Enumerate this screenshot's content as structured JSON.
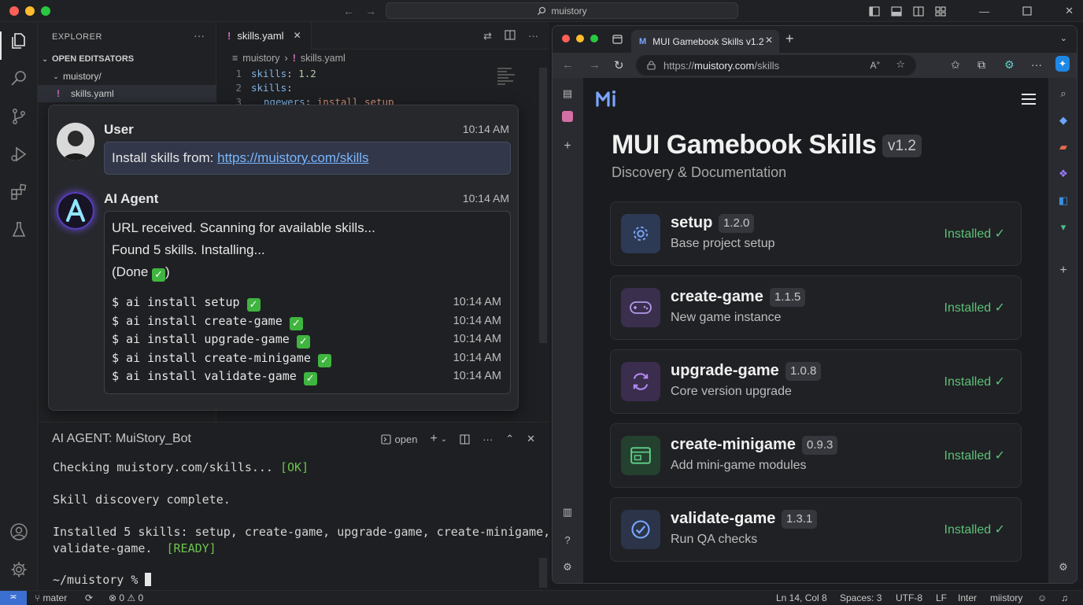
{
  "titlebar": {
    "search": "muistory"
  },
  "explorer": {
    "title": "EXPLORER",
    "section": "OPEN EDITSATORS",
    "folder": "muistory/",
    "file": "skills.yaml"
  },
  "editor": {
    "tab": "skills.yaml",
    "breadcrumb_folder": "muistory",
    "breadcrumb_file": "skills.yaml",
    "lines": [
      {
        "n": "1",
        "key": "skills",
        "value": "1.2"
      },
      {
        "n": "2",
        "key": "skills",
        "value": ""
      },
      {
        "n": "3",
        "key": "ngewers",
        "value": "install setup"
      }
    ]
  },
  "chat": {
    "user": {
      "name": "User",
      "time": "10:14 AM",
      "prefix": "Install skills from: ",
      "link": "https://muistory.com/skills"
    },
    "agent": {
      "name": "AI Agent",
      "time": "10:14 AM",
      "line1": "URL received. Scanning for available skills...",
      "line2": "Found 5 skills. Installing...",
      "line3": "(Done",
      "line3_end": ")",
      "commands": [
        {
          "cmd": "$ ai install setup",
          "time": "10:14 AM"
        },
        {
          "cmd": "$ ai install create-game",
          "time": "10:14 AM"
        },
        {
          "cmd": "$ ai install upgrade-game",
          "time": "10:14 AM"
        },
        {
          "cmd": "$ ai install create-minigame",
          "time": "10:14 AM"
        },
        {
          "cmd": "$ ai install validate-game",
          "time": "10:14 AM"
        }
      ]
    }
  },
  "panel": {
    "title": "AI AGENT: MuiStory_Bot",
    "open_label": "open",
    "line1": "Checking muistory.com/skills... ",
    "line1_ok": "[OK]",
    "line2": "Skill discovery complete.",
    "line3": "Installed 5 skills: setup, create-game, upgrade-game, create-minigame,",
    "line4": "validate-game.  ",
    "line4_ok": "[READY]",
    "prompt": "~/muistory % "
  },
  "status": {
    "branch": "mater",
    "errors": "0",
    "warnings": "0",
    "position": "Ln 14, Col 8",
    "spaces": "Spaces: 3",
    "encoding": "UTF-8",
    "eol": "LF",
    "language": "Inter",
    "project": "miistory"
  },
  "browser": {
    "tab_title": "MUI Gamebook Skills v1.2",
    "url_prefix": "https://",
    "url_domain": "muistory.com",
    "url_path": "/skills",
    "page": {
      "title": "MUI Gamebook Skills",
      "version": "v1.2",
      "subtitle": "Discovery & Documentation",
      "skills": [
        {
          "name": "setup",
          "version": "1.2.0",
          "desc": "Base project setup",
          "status": "Installed ✓",
          "icon": "gear-icon",
          "color": "#2d3a55"
        },
        {
          "name": "create-game",
          "version": "1.1.5",
          "desc": "New game instance",
          "status": "Installed ✓",
          "icon": "gamepad-icon",
          "color": "#3a2f4d"
        },
        {
          "name": "upgrade-game",
          "version": "1.0.8",
          "desc": "Core version upgrade",
          "status": "Installed ✓",
          "icon": "refresh-icon",
          "color": "#3a2d4d"
        },
        {
          "name": "create-minigame",
          "version": "0.9.3",
          "desc": "Add mini-game modules",
          "status": "Installed ✓",
          "icon": "window-icon",
          "color": "#24402f"
        },
        {
          "name": "validate-game",
          "version": "1.3.1",
          "desc": "Run QA checks",
          "status": "Installed ✓",
          "icon": "check-circle-icon",
          "color": "#2b3448"
        }
      ]
    }
  }
}
